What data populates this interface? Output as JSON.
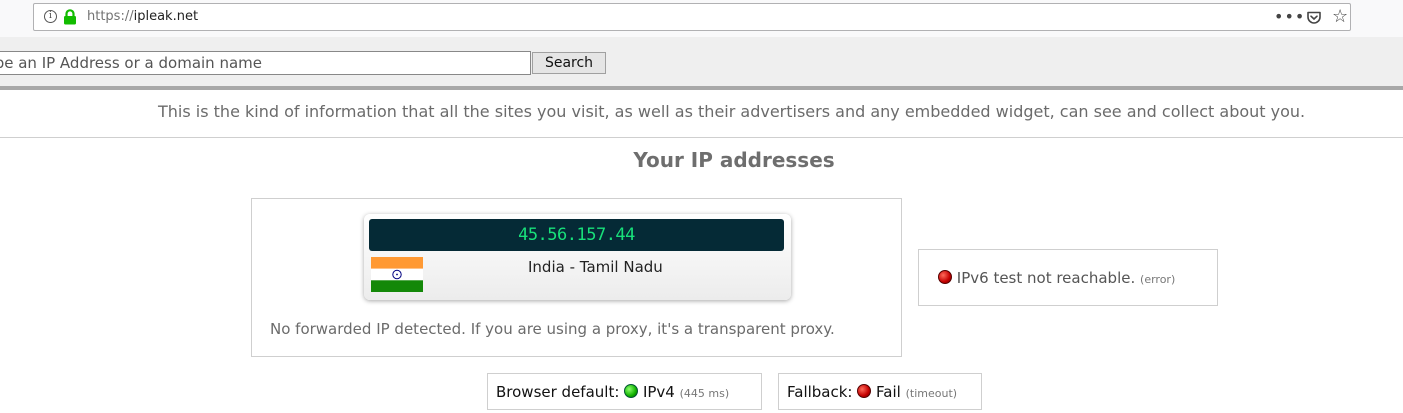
{
  "browser": {
    "url_protocol": "https://",
    "url_host": "ipleak.net",
    "icons": [
      "info-icon",
      "lock-icon",
      "page-actions-icon",
      "pocket-icon",
      "bookmark-star-icon"
    ]
  },
  "search": {
    "placeholder": "Type an IP Address or a domain name",
    "button_label": "Search"
  },
  "info_text": "This is the kind of information that all the sites you visit, as well as their advertisers and any embedded widget, can see and collect about you.",
  "section_title": "Your IP addresses",
  "ip_card": {
    "ip": "45.56.157.44",
    "location": "India - Tamil Nadu",
    "flag": "india-flag-icon"
  },
  "forward_note": "No forwarded IP detected. If you are using a proxy, it's a transparent proxy.",
  "ipv6": {
    "status": "IPv6 test not reachable.",
    "detail": "(error)",
    "status_color": "#d00000"
  },
  "browser_default": {
    "label": "Browser default:",
    "value": "IPv4",
    "detail": "(445 ms)",
    "status_color": "#11b300"
  },
  "fallback": {
    "label": "Fallback:",
    "value": "Fail",
    "detail": "(timeout)",
    "status_color": "#d00000"
  },
  "colors": {
    "ip_display_bg": "#052a36",
    "ip_digits": "#18e07a"
  }
}
